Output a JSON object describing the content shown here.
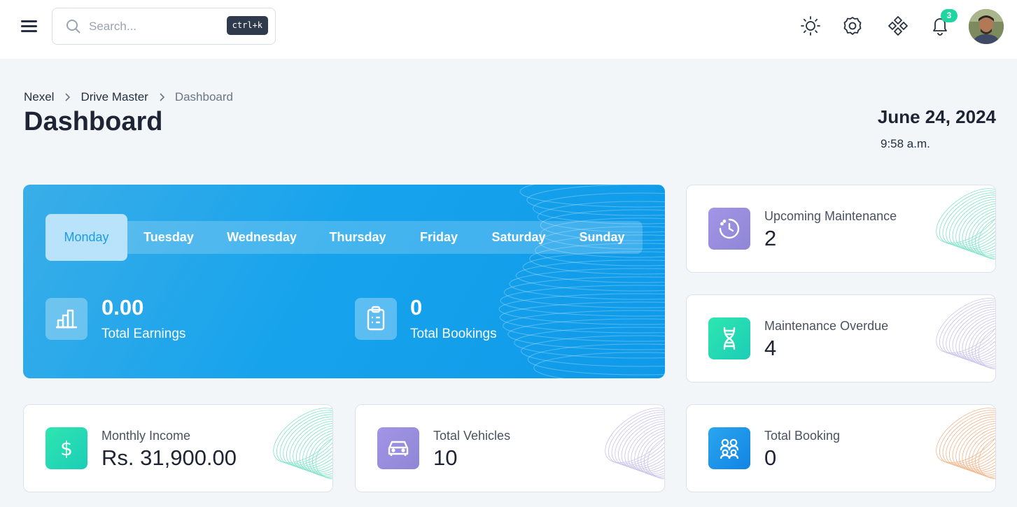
{
  "header": {
    "search_placeholder": "Search...",
    "search_shortcut": "ctrl+k",
    "notification_count": "3"
  },
  "breadcrumb": [
    "Nexel",
    "Drive Master",
    "Dashboard"
  ],
  "page_title": "Dashboard",
  "date": "June 24, 2024",
  "time": "9:58 a.m.",
  "days": {
    "active": "Monday",
    "items": [
      "Monday",
      "Tuesday",
      "Wednesday",
      "Thursday",
      "Friday",
      "Saturday",
      "Sunday"
    ]
  },
  "earnings": {
    "value": "0.00",
    "label": "Total Earnings"
  },
  "bookings": {
    "value": "0",
    "label": "Total Bookings"
  },
  "cards": {
    "upcoming": {
      "label": "Upcoming Maintenance",
      "value": "2",
      "color": "#9a8ee0"
    },
    "overdue": {
      "label": "Maintenance Overdue",
      "value": "4",
      "color": "#22d6a8"
    },
    "income": {
      "label": "Monthly Income",
      "value": "Rs. 31,900.00",
      "color": "#22d6a8"
    },
    "vehicles": {
      "label": "Total Vehicles",
      "value": "10",
      "color": "#9a8ee0"
    },
    "booking": {
      "label": "Total Booking",
      "value": "0",
      "color": "#1a98e8"
    }
  },
  "colors": {
    "brand_blue": "#17a3ec",
    "badge_green": "#1fd6a3"
  }
}
